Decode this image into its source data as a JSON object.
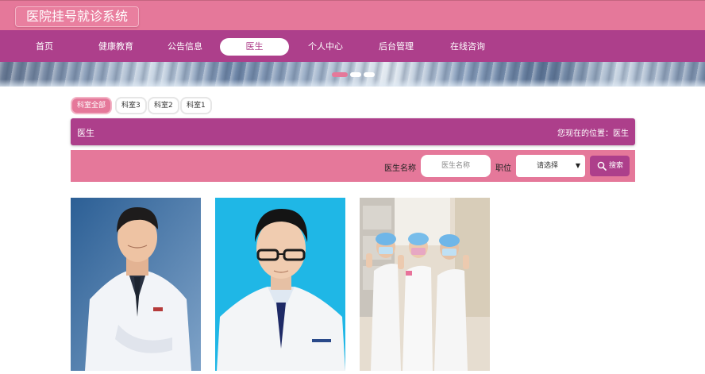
{
  "app": {
    "title": "医院挂号就诊系统"
  },
  "nav": {
    "items": [
      {
        "label": "首页",
        "active": false
      },
      {
        "label": "健康教育",
        "active": false
      },
      {
        "label": "公告信息",
        "active": false
      },
      {
        "label": "医生",
        "active": true
      },
      {
        "label": "个人中心",
        "active": false
      },
      {
        "label": "后台管理",
        "active": false
      },
      {
        "label": "在线咨询",
        "active": false
      }
    ]
  },
  "banner": {
    "slide_count": 3,
    "active_slide": 1
  },
  "filters": {
    "chips": [
      {
        "label": "科室全部",
        "active": true
      },
      {
        "label": "科室3",
        "active": false
      },
      {
        "label": "科室2",
        "active": false
      },
      {
        "label": "科室1",
        "active": false
      }
    ]
  },
  "section": {
    "title": "医生",
    "breadcrumb": "您现在的位置：医生"
  },
  "search": {
    "name_label": "医生名称",
    "name_placeholder": "医生名称",
    "position_label": "职位",
    "position_value": "请选择",
    "button_label": "搜索"
  },
  "doctors": [
    {
      "photo": "doctor-photo-1"
    },
    {
      "photo": "doctor-photo-2"
    },
    {
      "photo": "doctor-photo-3"
    }
  ],
  "colors": {
    "pink": "#e5789a",
    "purple": "#ad3f8b"
  }
}
